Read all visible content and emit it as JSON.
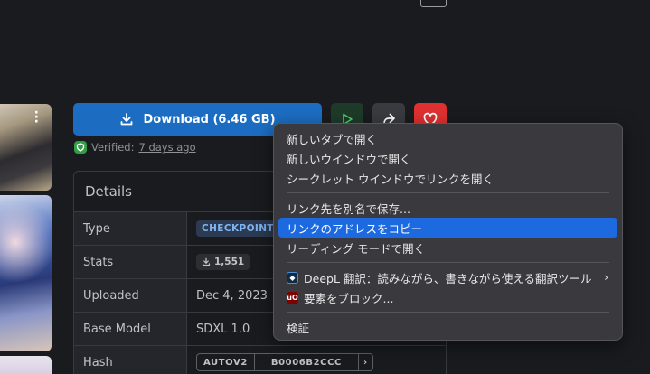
{
  "download": {
    "label": "Download (6.46 GB)"
  },
  "verified": {
    "prefix": "Verified:",
    "ago": "7 days ago"
  },
  "details": {
    "title": "Details",
    "rows": [
      {
        "key": "Type",
        "value": "CHECKPOINT"
      },
      {
        "key": "Stats",
        "value": "1,551"
      },
      {
        "key": "Uploaded",
        "value": "Dec 4, 2023"
      },
      {
        "key": "Base Model",
        "value": "SDXL 1.0"
      },
      {
        "key": "Hash",
        "hash_type": "AUTOV2",
        "hash_value": "B0006B2CCC"
      }
    ]
  },
  "context_menu": {
    "items": [
      "新しいタブで開く",
      "新しいウインドウで開く",
      "シークレット ウインドウでリンクを開く",
      "リンク先を別名で保存...",
      "リンクのアドレスをコピー",
      "リーディング モードで開く",
      "DeepL 翻訳：読みながら、書きながら使える翻訳ツール",
      "要素をブロック...",
      "検証"
    ],
    "active_index": 4
  },
  "colors": {
    "accent": "#1c6dc2",
    "menu_highlight": "#1d6ae0",
    "heart": "#e03131",
    "play_bg": "#1e3b2a"
  },
  "icons": [
    "download-icon",
    "play-icon",
    "share-icon",
    "heart-icon",
    "shield-check-icon",
    "chevron-right-icon",
    "deepl-icon",
    "ublock-icon",
    "more-dots-icon"
  ]
}
